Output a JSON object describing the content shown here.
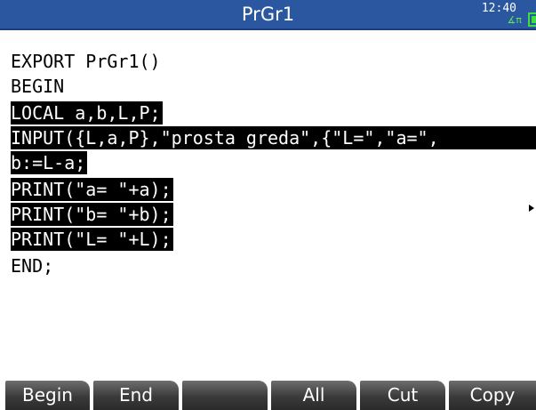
{
  "status_bar": {
    "title": "PrGr1",
    "clock": "12:40",
    "angle_mode": "∡π",
    "colors": {
      "title_bar": "#2a57a0",
      "battery": "#3ce03c"
    }
  },
  "editor": {
    "lines": [
      {
        "text": "EXPORT PrGr1()",
        "selected": false
      },
      {
        "text": "BEGIN",
        "selected": false
      },
      {
        "text": "LOCAL a,b,L,P;",
        "selected": true
      },
      {
        "text": "INPUT({L,a,P},\"prosta greda\",{\"L=\",\"a=\",",
        "selected": true
      },
      {
        "text": "b:=L-a;",
        "selected": true
      },
      {
        "text": "PRINT(\"a= \"+a);",
        "selected": true
      },
      {
        "text": "PRINT(\"b= \"+b);",
        "selected": true
      },
      {
        "text": "PRINT(\"L= \"+L);",
        "selected": true
      },
      {
        "text": "END;",
        "selected": false
      }
    ],
    "overflow_indicator": "right-arrow-icon"
  },
  "softkeys": [
    {
      "label": "Begin"
    },
    {
      "label": "End"
    },
    {
      "label": ""
    },
    {
      "label": "All"
    },
    {
      "label": "Cut"
    },
    {
      "label": "Copy"
    }
  ]
}
